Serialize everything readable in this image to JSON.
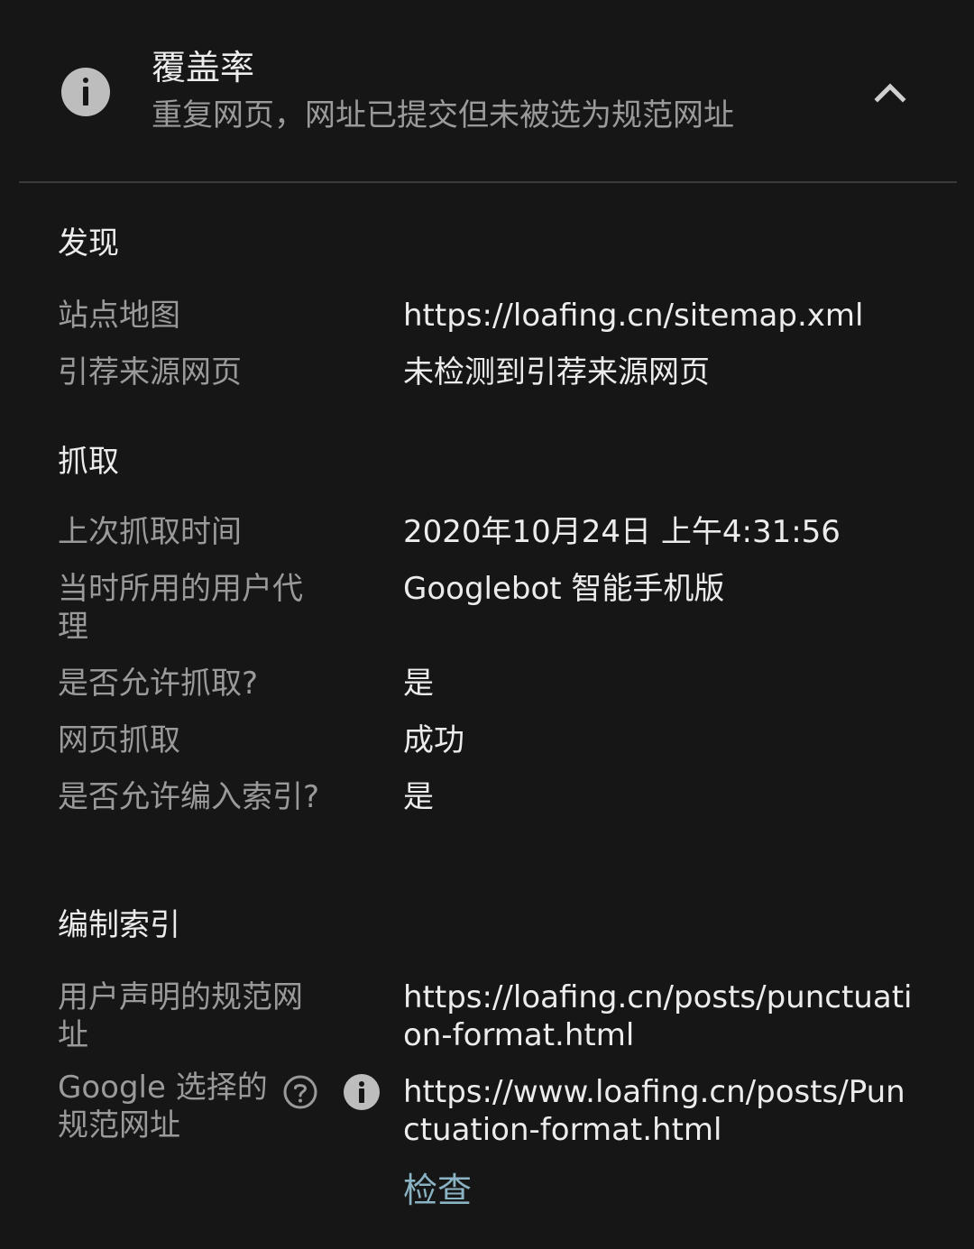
{
  "header": {
    "icon": "info-icon",
    "title": "覆盖率",
    "subtitle": "重复网页，网址已提交但未被选为规范网址",
    "collapse_icon": "chevron-up-icon"
  },
  "discovery": {
    "title": "发现",
    "rows": [
      {
        "label": "站点地图",
        "value": "https://loafing.cn/sitemap.xml"
      },
      {
        "label": "引荐来源网页",
        "value": "未检测到引荐来源网页"
      }
    ]
  },
  "crawl": {
    "title": "抓取",
    "rows": [
      {
        "label": "上次抓取时间",
        "value": "2020年10月24日 上午4:31:56"
      },
      {
        "label": "当时所用的用户代理",
        "value": "Googlebot 智能手机版"
      },
      {
        "label": "是否允许抓取?",
        "value": "是"
      },
      {
        "label": "网页抓取",
        "value": "成功"
      },
      {
        "label": "是否允许编入索引?",
        "value": "是"
      }
    ]
  },
  "indexing": {
    "title": "编制索引",
    "rows": [
      {
        "label": "用户声明的规范网址",
        "value": "https://loafing.cn/posts/punctuation-format.html"
      },
      {
        "label": "Google 选择的规范网址",
        "value": "https://www.loafing.cn/posts/Punctuation-format.html"
      }
    ],
    "inspect_label": "检查"
  },
  "colors": {
    "background": "#161616",
    "primary_text": "#ececec",
    "secondary_text": "#9a9a9a",
    "link": "#8ab4c4",
    "icon": "#bdbdbd"
  }
}
